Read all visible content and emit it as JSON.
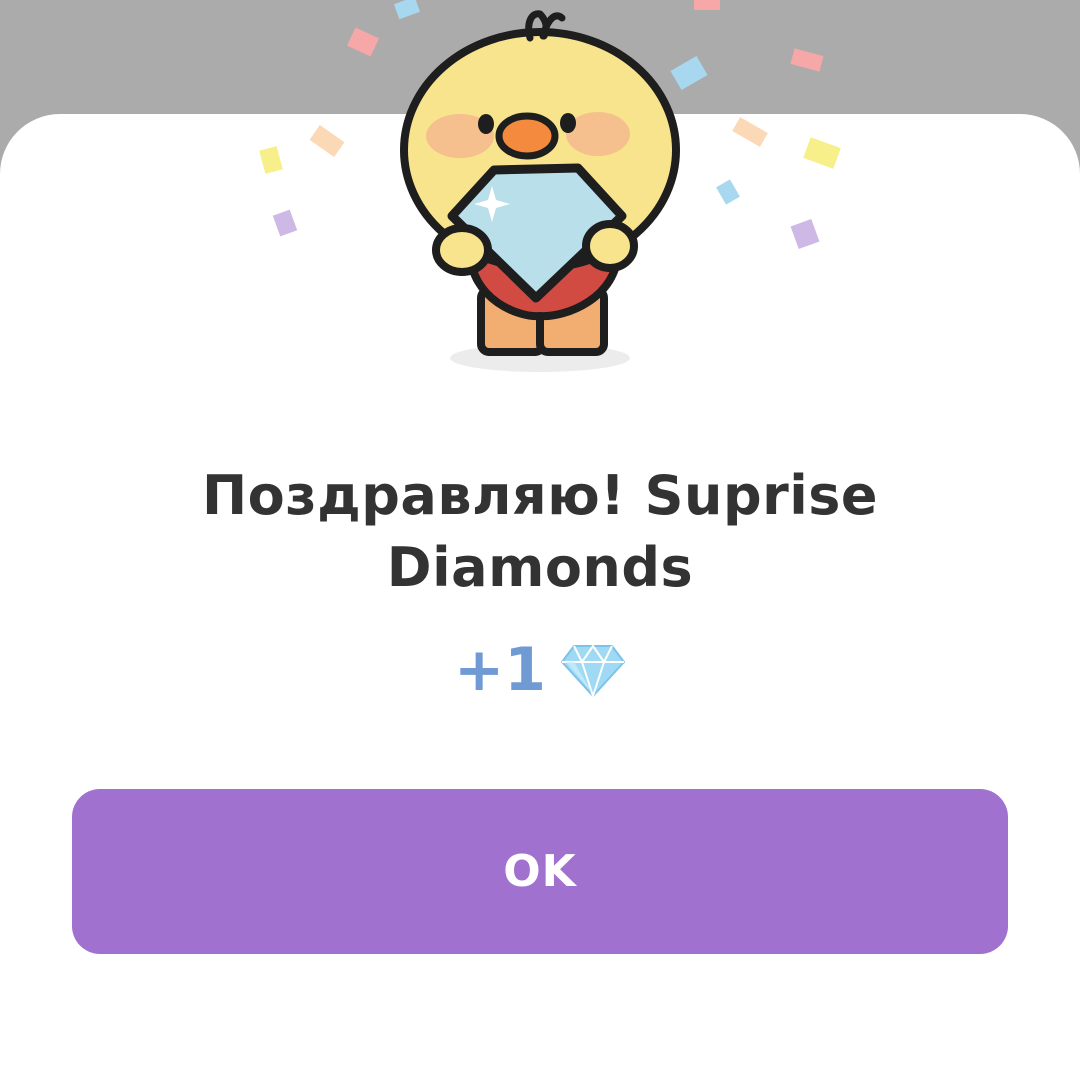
{
  "dialog": {
    "title": "Поздравляю! Suprise Diamonds",
    "reward_amount": "+1",
    "reward_icon": "diamond-icon",
    "ok_label": "OK"
  },
  "colors": {
    "backdrop": "#ababab",
    "sheet": "#ffffff",
    "title_text": "#333333",
    "reward_text": "#6f9ad4",
    "button": "#a071cf",
    "button_text": "#ffffff"
  }
}
